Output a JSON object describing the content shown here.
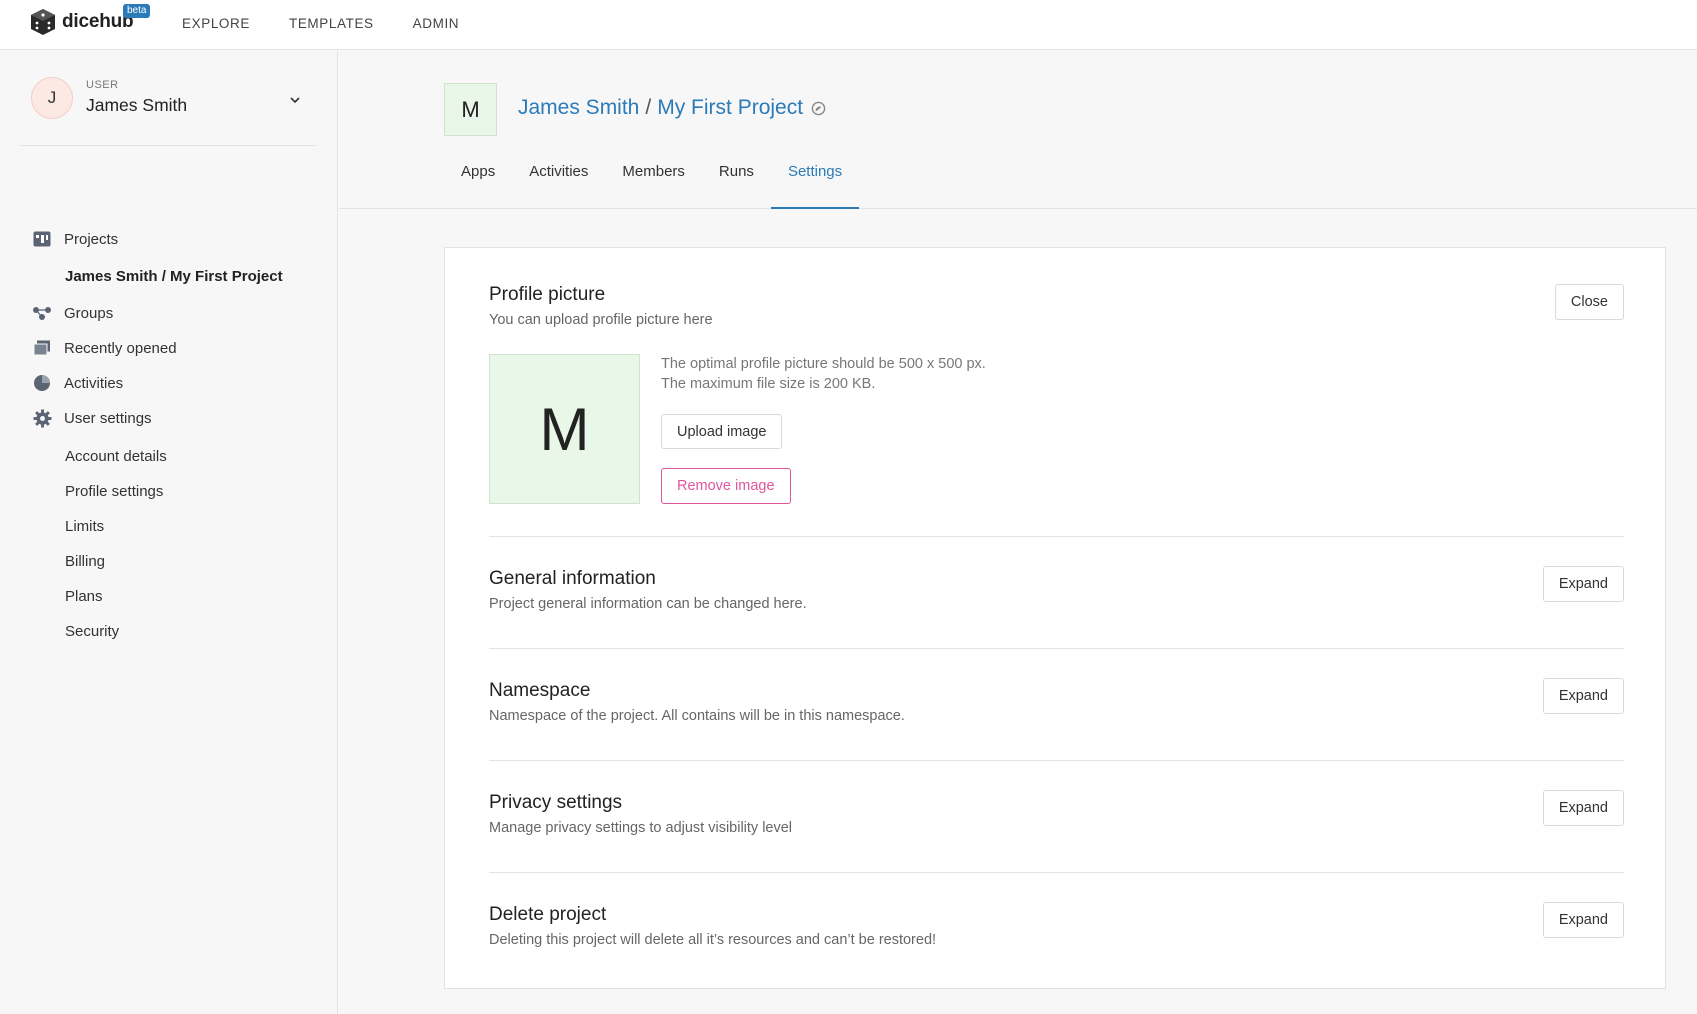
{
  "app": {
    "name": "dicehub",
    "badge": "beta"
  },
  "topnav": [
    {
      "label": "EXPLORE"
    },
    {
      "label": "TEMPLATES"
    },
    {
      "label": "ADMIN"
    }
  ],
  "user": {
    "initial": "J",
    "role": "USER",
    "name": "James Smith"
  },
  "sidebar": {
    "projects": "Projects",
    "current_project": "James Smith / My First Project",
    "groups": "Groups",
    "recently_opened": "Recently opened",
    "activities": "Activities",
    "user_settings": "User settings",
    "sub": [
      "Account details",
      "Profile settings",
      "Limits",
      "Billing",
      "Plans",
      "Security"
    ]
  },
  "project": {
    "initial": "M",
    "owner": "James Smith",
    "separator": "/",
    "name": "My First Project"
  },
  "tabs": [
    {
      "label": "Apps"
    },
    {
      "label": "Activities"
    },
    {
      "label": "Members"
    },
    {
      "label": "Runs"
    },
    {
      "label": "Settings"
    }
  ],
  "profile_picture": {
    "title": "Profile picture",
    "desc": "You can upload profile picture here",
    "close_label": "Close",
    "initial": "M",
    "info_line1": "The optimal profile picture should be 500 x 500 px.",
    "info_line2": "The maximum file size is 200 KB.",
    "upload_label": "Upload image",
    "remove_label": "Remove image"
  },
  "sections": [
    {
      "title": "General information",
      "desc": "Project general information can be changed here.",
      "btn": "Expand"
    },
    {
      "title": "Namespace",
      "desc": "Namespace of the project. All contains will be in this namespace.",
      "btn": "Expand"
    },
    {
      "title": "Privacy settings",
      "desc": "Manage privacy settings to adjust visibility level",
      "btn": "Expand"
    },
    {
      "title": "Delete project",
      "desc": "Deleting this project will delete all it’s resources and can’t be restored!",
      "btn": "Expand"
    }
  ],
  "colors": {
    "accent": "#2b7bb9",
    "danger": "#e0559b",
    "project_avatar_bg": "#e8f7e8"
  }
}
